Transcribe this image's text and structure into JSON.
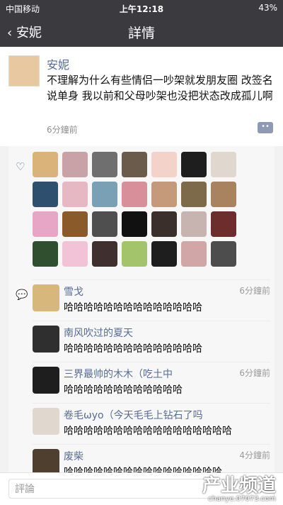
{
  "status": {
    "carrier": "中国移动",
    "time": "上午12:18",
    "battery": "43%"
  },
  "nav": {
    "back": "安妮",
    "title": "詳情"
  },
  "post": {
    "author": "安妮",
    "content": "不理解为什么有些情侣一吵架就发朋友圈 改签名说单身 我以前和父母吵架也没把状态改成孤儿啊",
    "time": "6分鐘前"
  },
  "comments": [
    {
      "name": "雪戈",
      "time": "6分鐘前",
      "text": "哈哈哈哈哈哈哈哈哈哈哈哈哈哈"
    },
    {
      "name": "南风吹过的夏天",
      "time": "",
      "text": "哈哈哈哈哈哈哈哈哈哈哈哈哈哈"
    },
    {
      "name": "三界最帅的木木（吃土中",
      "time": "6分鐘前",
      "text": "哈哈哈哈哈哈哈哈哈哈哈哈"
    },
    {
      "name": "卷毛ωyo（今天毛毛上钻石了吗",
      "time": "",
      "text": "哈哈哈哈哈哈哈哈哈哈哈哈哈哈哈哈哈"
    },
    {
      "name": "废柴",
      "time": "4分鐘前",
      "text": "哈哈哈哈哈哈哈哈哈哈哈哈哈哈哈哈"
    }
  ],
  "input": {
    "placeholder": "評論"
  },
  "watermark": {
    "title": "产业频道",
    "sub": "chanye.07073.com"
  }
}
